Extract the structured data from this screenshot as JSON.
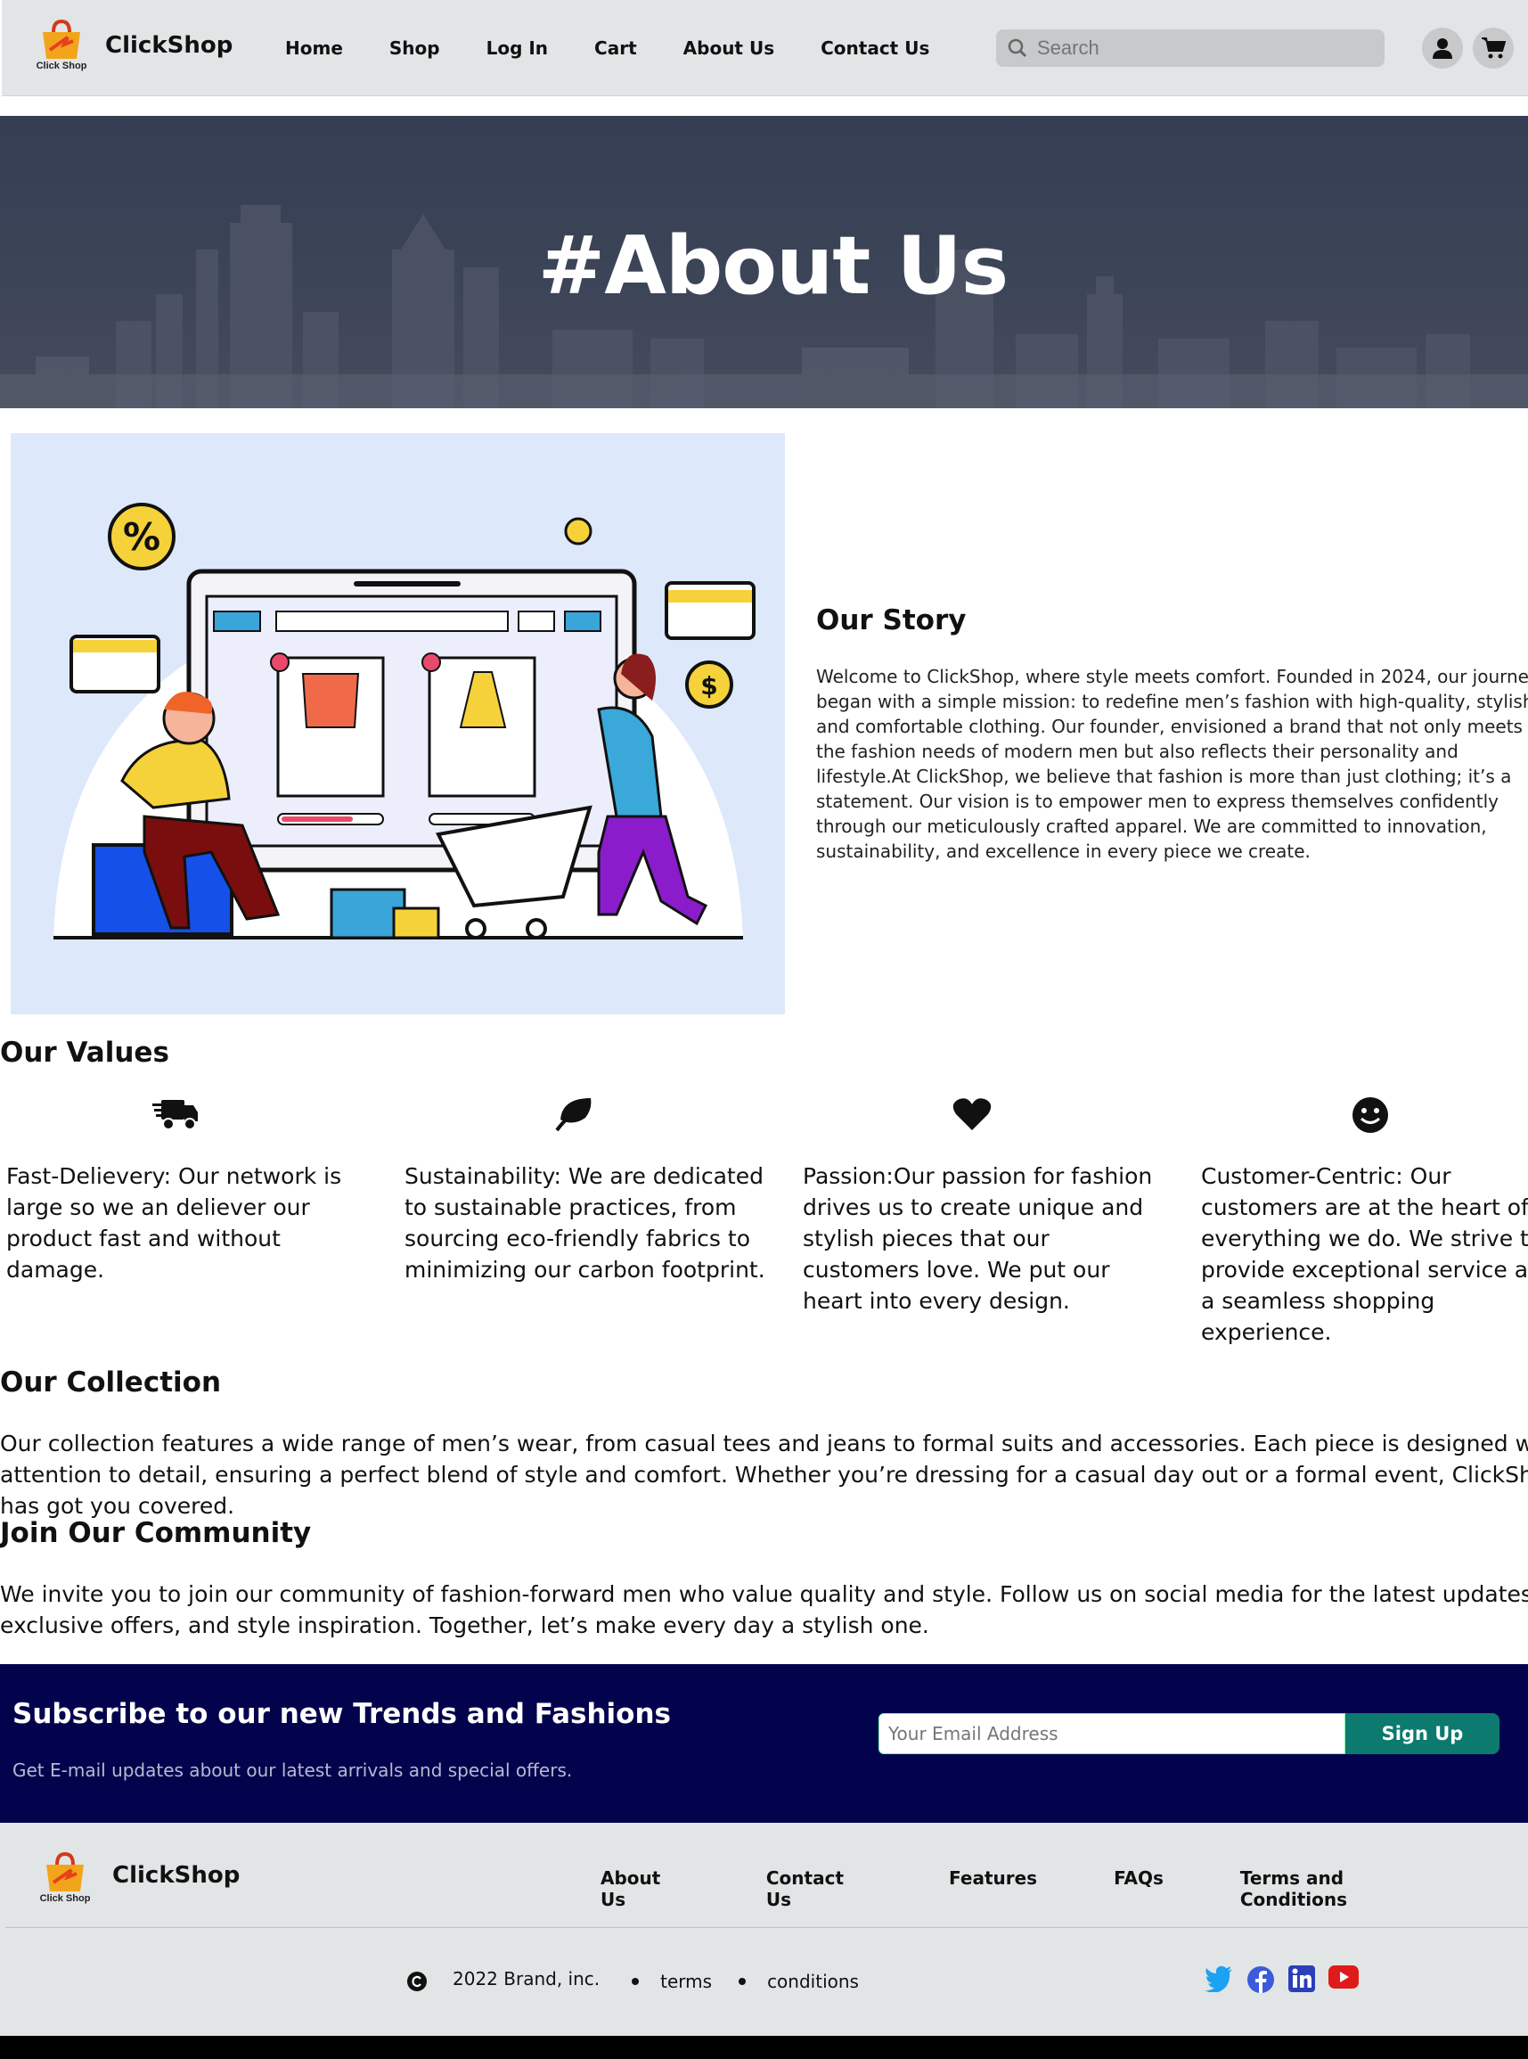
{
  "header": {
    "logo_text": "Click Shop",
    "brand": "ClickShop",
    "nav": [
      "Home",
      "Shop",
      "Log In",
      "Cart",
      "About Us",
      "Contact Us"
    ],
    "search_placeholder": "Search"
  },
  "hero": {
    "title": "#About Us"
  },
  "story": {
    "title": "Our Story",
    "text": "Welcome to ClickShop, where style meets comfort. Founded in 2024, our journey began with a simple mission: to redefine men’s fashion with high-quality, stylish, and comfortable clothing. Our founder, envisioned a brand that not only meets the fashion needs of modern men but also reflects their personality and lifestyle.At ClickShop, we believe that fashion is more than just clothing; it’s a statement. Our vision is to empower men to express themselves confidently through our meticulously crafted apparel. We are committed to innovation, sustainability, and excellence in every piece we create."
  },
  "values": {
    "title": "Our Values",
    "items": [
      {
        "icon": "truck-icon",
        "text": "Fast-Delievery: Our network is large so we an deliever our product fast and without damage."
      },
      {
        "icon": "leaf-icon",
        "text": "Sustainability: We are dedicated to sustainable practices, from sourcing eco-friendly fabrics to minimizing our carbon footprint."
      },
      {
        "icon": "heart-icon",
        "text": "Passion:Our passion for fashion drives us to create unique and stylish pieces that our customers love. We put our heart into every design."
      },
      {
        "icon": "smile-icon",
        "text": "Customer-Centric: Our customers are at the heart of everything we do. We strive to provide exceptional service and a seamless shopping experience."
      }
    ]
  },
  "collection": {
    "title": "Our Collection",
    "text": "Our collection features a wide range of men’s wear, from casual tees and jeans to formal suits and accessories. Each piece is designed with attention to detail, ensuring a perfect blend of style and comfort. Whether you’re dressing for a casual day out or a formal event, ClickShop has got you covered."
  },
  "community": {
    "title": "Join Our Community",
    "text": "We invite you to join our community of fashion-forward men who value quality and style. Follow us on social media for the latest updates, exclusive offers, and style inspiration. Together, let’s make every day a stylish one."
  },
  "newsletter": {
    "title": "Subscribe to our new Trends and Fashions",
    "subtitle": "Get E-mail updates about our latest arrivals and special offers.",
    "email_placeholder": "Your Email Address",
    "button": "Sign Up"
  },
  "footer": {
    "brand": "ClickShop",
    "links": [
      "About Us",
      "Contact Us",
      "Features",
      "FAQs",
      "Terms and Conditions"
    ],
    "copyright": "2022 Brand, inc.",
    "terms": "terms",
    "conditions": "conditions",
    "socials": [
      "twitter-icon",
      "facebook-icon",
      "linkedin-icon",
      "youtube-icon"
    ]
  },
  "colors": {
    "header_bg": "#e2e5e6",
    "hero_bg": "#3a4256",
    "newsletter_bg": "#03034d",
    "signup_btn": "#0c7a6e",
    "illustration_bg": "#dde8fb"
  }
}
